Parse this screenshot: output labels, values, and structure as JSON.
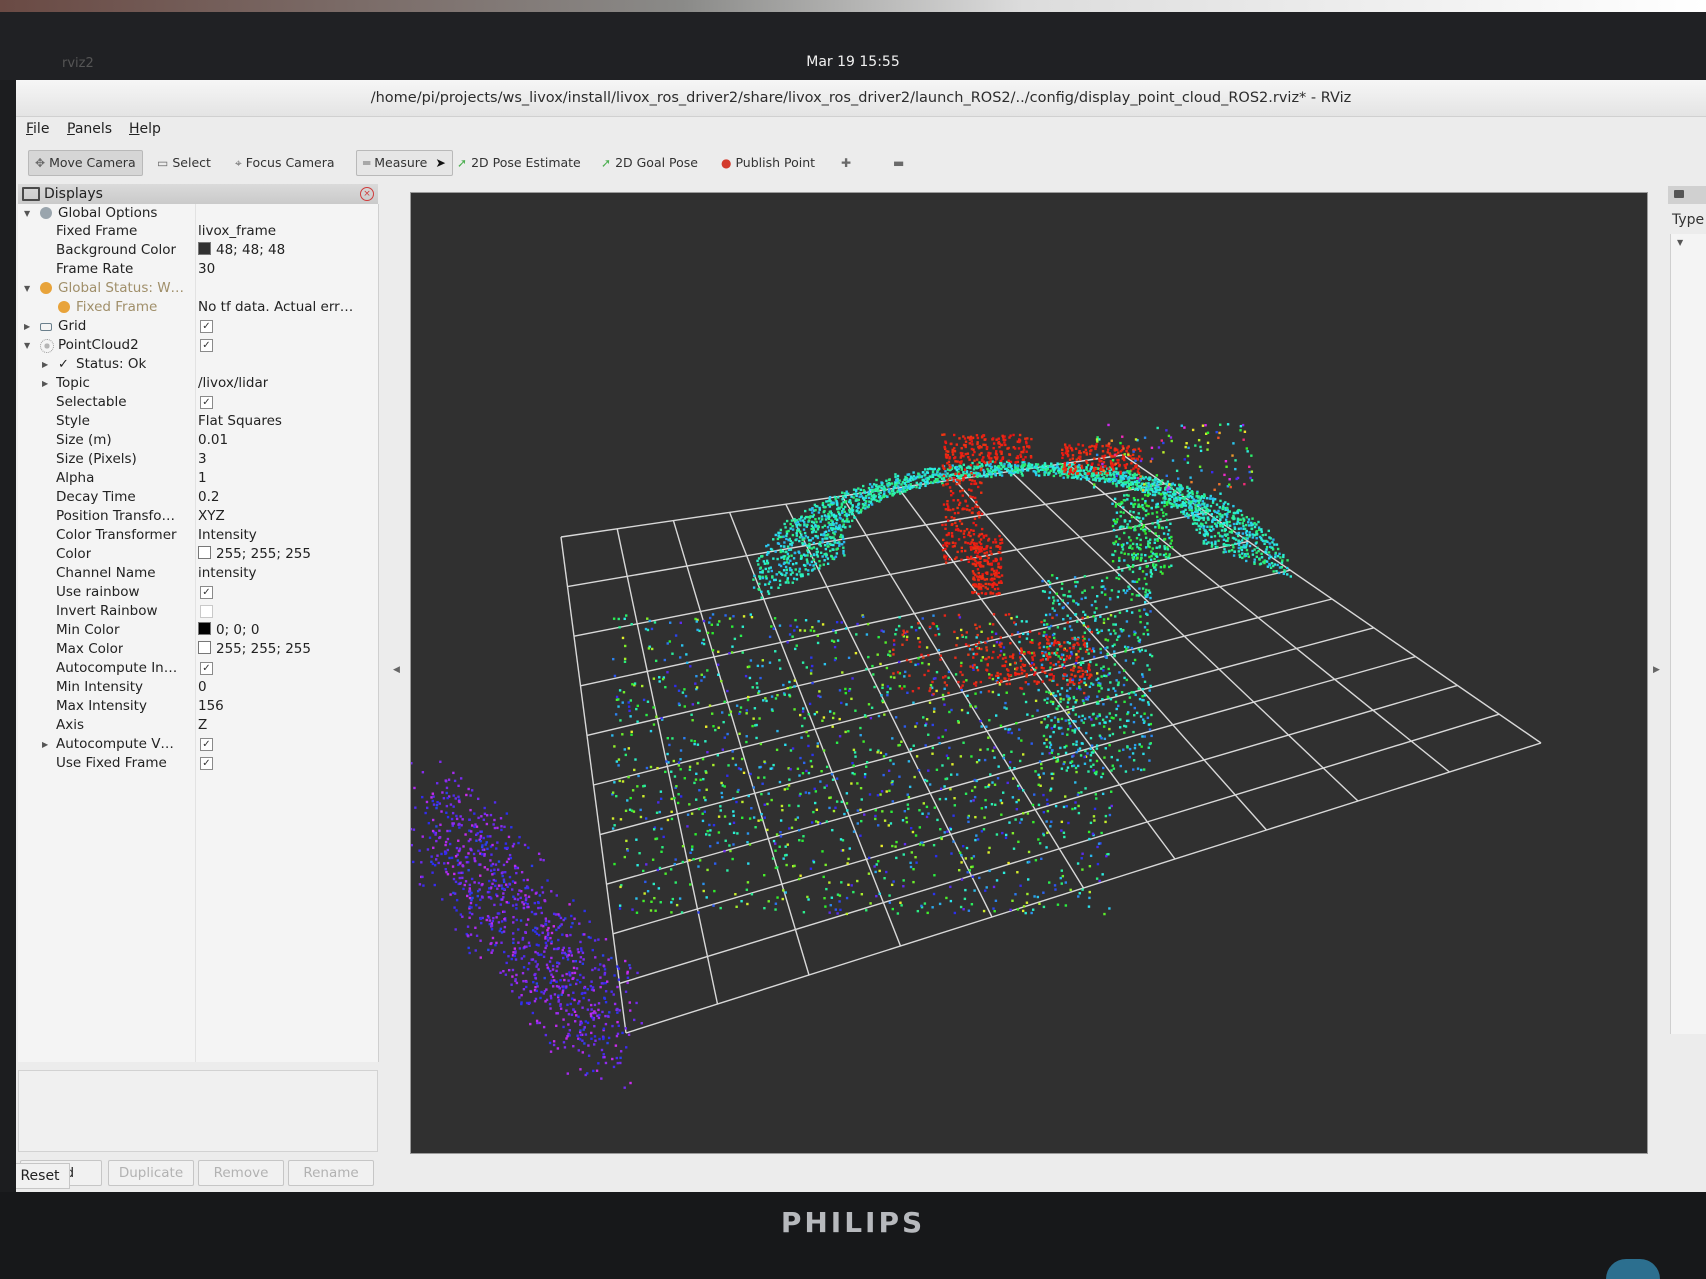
{
  "system": {
    "clock": "Mar 19 15:55",
    "activities": "rviz2",
    "monitor_brand": "PHILIPS"
  },
  "window": {
    "title": "/home/pi/projects/ws_livox/install/livox_ros_driver2/share/livox_ros_driver2/launch_ROS2/../config/display_point_cloud_ROS2.rviz* - RViz"
  },
  "menu": [
    "File",
    "Panels",
    "Help"
  ],
  "toolbar": [
    {
      "label": "Move Camera",
      "icon": "move-camera-icon",
      "active": true
    },
    {
      "label": "Select",
      "icon": "select-icon"
    },
    {
      "label": "Focus Camera",
      "icon": "focus-camera-icon"
    },
    {
      "label": "Measure",
      "icon": "measure-icon"
    },
    {
      "label": "2D Pose Estimate",
      "icon": "pose-estimate-icon"
    },
    {
      "label": "2D Goal Pose",
      "icon": "goal-pose-icon"
    },
    {
      "label": "Publish Point",
      "icon": "publish-point-icon"
    }
  ],
  "colors": {
    "viewport_bg": "#303030",
    "warn": "#e8a33a",
    "grid": "#d8d8d8"
  },
  "displays": {
    "title": "Displays",
    "rows": {
      "global_options": "Global Options",
      "fixed_frame_label": "Fixed Frame",
      "fixed_frame_value": "livox_frame",
      "bg_color_label": "Background Color",
      "bg_color_value": "48; 48; 48",
      "frame_rate_label": "Frame Rate",
      "frame_rate_value": "30",
      "global_status_label": "Global Status: W…",
      "status_fixed_frame_label": "Fixed Frame",
      "status_fixed_frame_value": "No tf data.  Actual err…",
      "grid_label": "Grid",
      "pointcloud_label": "PointCloud2",
      "status_ok_label": "Status: Ok",
      "topic_label": "Topic",
      "topic_value": "/livox/lidar",
      "selectable_label": "Selectable",
      "style_label": "Style",
      "style_value": "Flat Squares",
      "size_m_label": "Size (m)",
      "size_m_value": "0.01",
      "size_px_label": "Size (Pixels)",
      "size_px_value": "3",
      "alpha_label": "Alpha",
      "alpha_value": "1",
      "decay_label": "Decay Time",
      "decay_value": "0.2",
      "pos_tf_label": "Position Transfo…",
      "pos_tf_value": "XYZ",
      "color_tf_label": "Color Transformer",
      "color_tf_value": "Intensity",
      "color_label": "Color",
      "color_value": "255; 255; 255",
      "channel_label": "Channel Name",
      "channel_value": "intensity",
      "use_rainbow_label": "Use rainbow",
      "invert_rainbow_label": "Invert Rainbow",
      "min_color_label": "Min Color",
      "min_color_value": "0; 0; 0",
      "max_color_label": "Max Color",
      "max_color_value": "255; 255; 255",
      "autocompute_in_label": "Autocompute In…",
      "min_int_label": "Min Intensity",
      "min_int_value": "0",
      "max_int_label": "Max Intensity",
      "max_int_value": "156",
      "axis_label": "Axis",
      "axis_value": "Z",
      "autocompute_v_label": "Autocompute V…",
      "use_fixed_frame_label": "Use Fixed Frame"
    },
    "buttons": {
      "add": "Add",
      "duplicate": "Duplicate",
      "remove": "Remove",
      "rename": "Rename"
    },
    "reset": "Reset"
  },
  "views": {
    "type_label": "Type"
  }
}
